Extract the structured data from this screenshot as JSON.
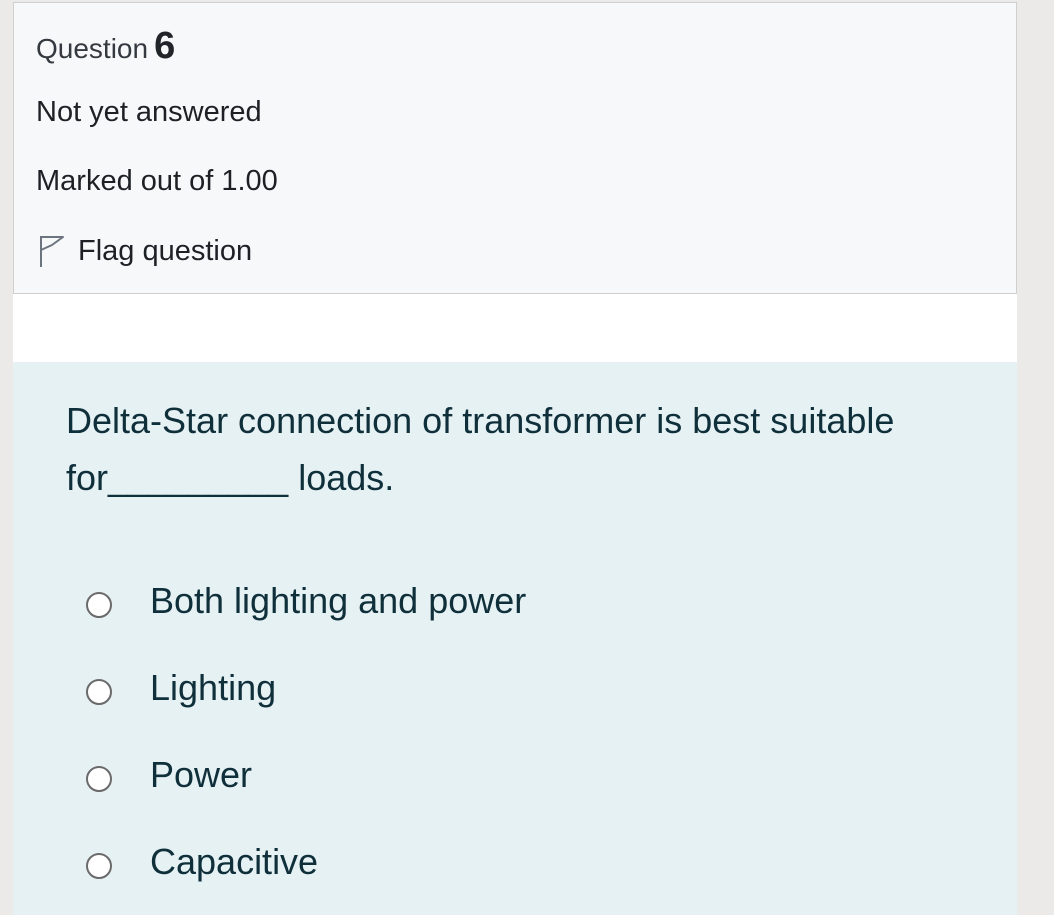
{
  "question_info": {
    "label": "Question",
    "number": "6",
    "status": "Not yet answered",
    "marks": "Marked out of 1.00",
    "flag_label": "Flag question"
  },
  "question": {
    "text": "Delta-Star connection of transformer is best suitable for_________ loads."
  },
  "answers": [
    {
      "label": "Both lighting and power",
      "selected": false
    },
    {
      "label": "Lighting",
      "selected": false
    },
    {
      "label": "Power",
      "selected": false
    },
    {
      "label": "Capacitive",
      "selected": false
    }
  ],
  "icons": {
    "flag": "flag-outline-icon",
    "radio": "radio-unselected-icon"
  },
  "colors": {
    "info_background": "#f7f8fa",
    "content_background": "#e6f1f4",
    "text": "#1d2125"
  }
}
